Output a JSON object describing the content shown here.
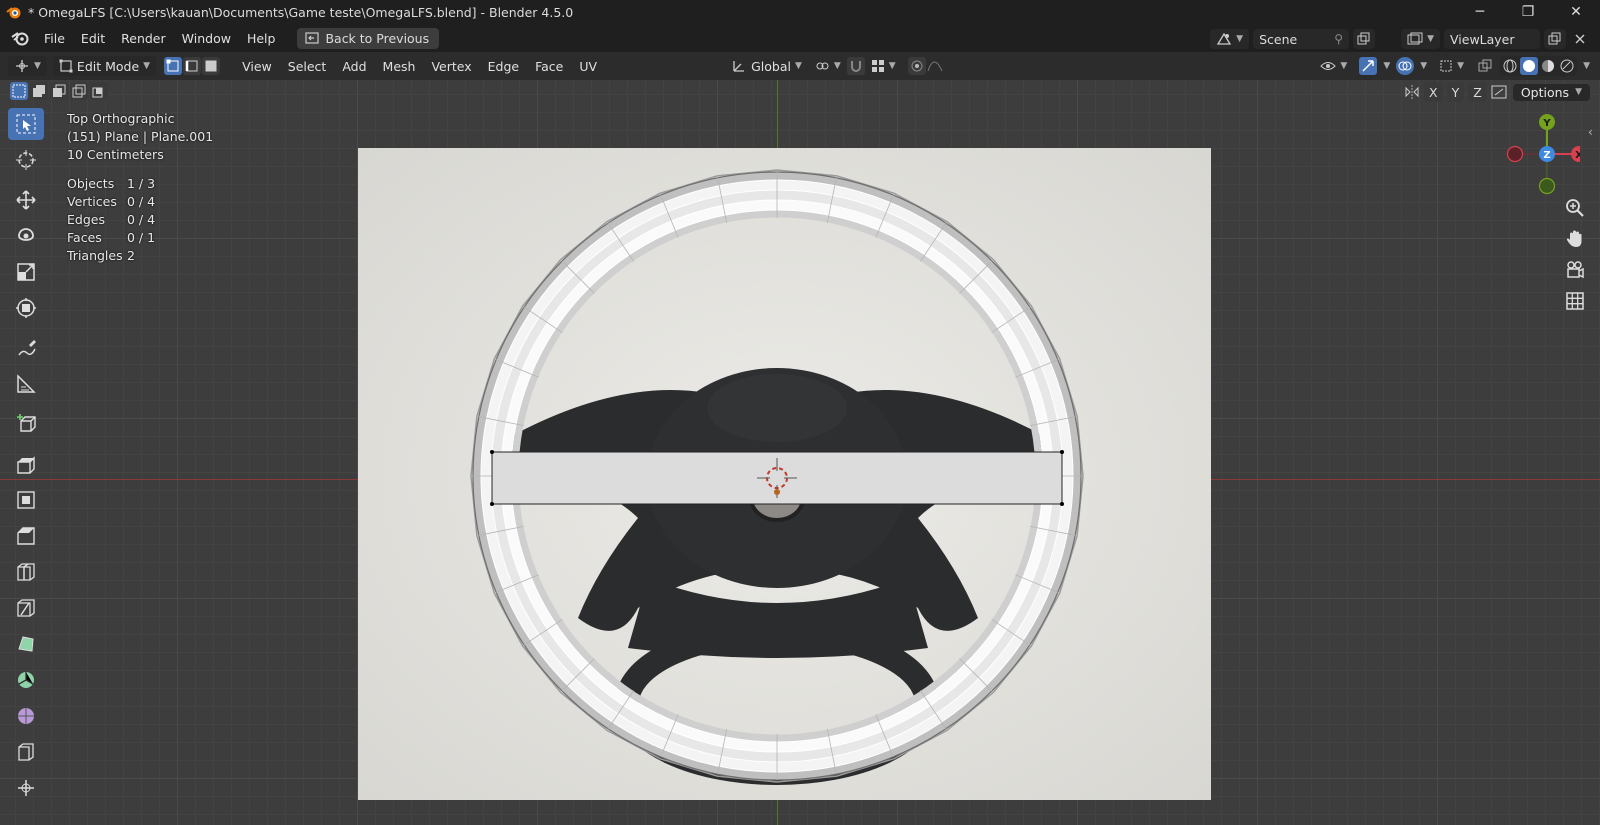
{
  "window": {
    "title": "* OmegaLFS [C:\\Users\\kauan\\Documents\\Game teste\\OmegaLFS.blend] - Blender 4.5.0",
    "controls": {
      "minimize": "─",
      "maximize": "❐",
      "close": "✕"
    }
  },
  "menubar": {
    "items": [
      "File",
      "Edit",
      "Render",
      "Window",
      "Help"
    ],
    "back_label": "Back to Previous",
    "scene": "Scene",
    "view_layer": "ViewLayer"
  },
  "header": {
    "mode": "Edit Mode",
    "menus": [
      "View",
      "Select",
      "Add",
      "Mesh",
      "Vertex",
      "Edge",
      "Face",
      "UV"
    ],
    "orientation": "Global"
  },
  "viewport": {
    "options_label": "Options",
    "axes": {
      "x": "X",
      "y": "Y",
      "z": "Z"
    },
    "overlay": {
      "view_name": "Top Orthographic",
      "object_name": "(151) Plane | Plane.001",
      "scale": "10 Centimeters",
      "stats": [
        {
          "label": "Objects",
          "value": "1 / 3"
        },
        {
          "label": "Vertices",
          "value": "0 / 4"
        },
        {
          "label": "Edges",
          "value": "0 / 4"
        },
        {
          "label": "Faces",
          "value": "0 / 1"
        },
        {
          "label": "Triangles",
          "value": "2"
        }
      ]
    },
    "gizmo": {
      "x": "X",
      "y": "Y",
      "z": "Z"
    }
  },
  "colors": {
    "accent": "#4772b3",
    "axis_x": "#d9404f",
    "axis_y": "#75a21e",
    "axis_z": "#3d8ae0",
    "grid_bg": "#3d3d3d"
  },
  "tools": [
    "select-box-icon",
    "cursor-icon",
    "move-icon",
    "rotate-icon",
    "scale-icon",
    "transform-icon",
    "annotate-icon",
    "measure-icon",
    "add-cube-icon",
    "extrude-icon",
    "inset-icon",
    "bevel-icon",
    "loop-cut-icon",
    "knife-icon",
    "poly-build-icon",
    "spin-icon",
    "smooth-icon",
    "edge-slide-icon",
    "shrink-fatten-icon",
    "shear-icon"
  ]
}
